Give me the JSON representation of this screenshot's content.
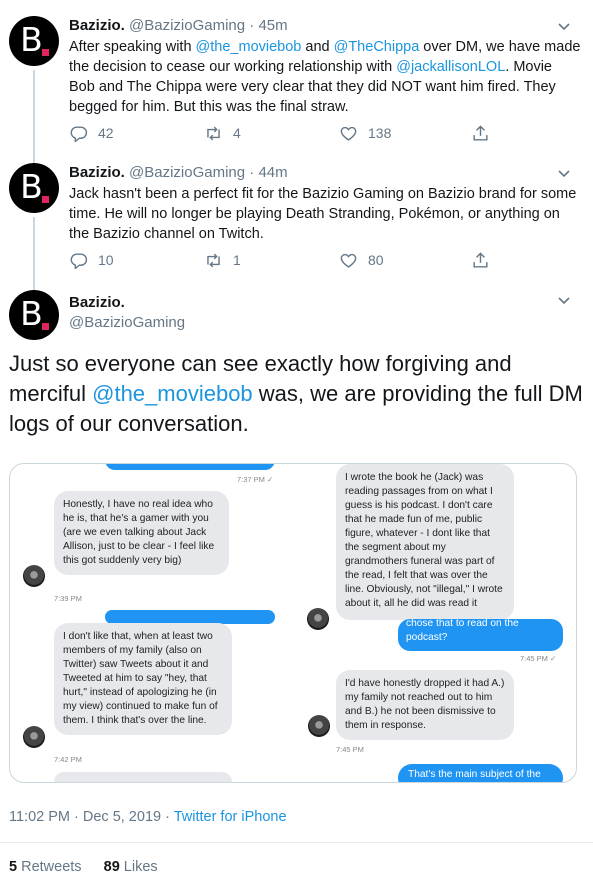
{
  "tweets": [
    {
      "name": "Bazizio.",
      "handle": "@BazizioGaming",
      "sep": " · ",
      "time": "45m",
      "segments": [
        {
          "t": "After speaking with ",
          "link": false
        },
        {
          "t": "@the_moviebob",
          "link": true
        },
        {
          "t": " and ",
          "link": false
        },
        {
          "t": "@TheChippa",
          "link": true
        },
        {
          "t": " over DM, we have made the decision to cease our working relationship with ",
          "link": false
        },
        {
          "t": "@jackallisonLOL",
          "link": true
        },
        {
          "t": ". Movie Bob and The Chippa were very clear that they did NOT want him fired. They begged for him. But this was the final straw.",
          "link": false
        }
      ],
      "replies": "42",
      "retweets": "4",
      "likes": "138"
    },
    {
      "name": "Bazizio.",
      "handle": "@BazizioGaming",
      "sep": " · ",
      "time": "44m",
      "segments": [
        {
          "t": "Jack hasn't been a perfect fit for the Bazizio Gaming on Bazizio brand for some time. He will no longer be playing Death Stranding, Pokémon, or anything on the Bazizio channel on Twitch.",
          "link": false
        }
      ],
      "replies": "10",
      "retweets": "1",
      "likes": "80"
    }
  ],
  "main": {
    "name": "Bazizio.",
    "handle": "@BazizioGaming",
    "text_before": "Just so everyone can see exactly how forgiving and merciful ",
    "text_link": "@the_moviebob",
    "text_after": " was, we are providing the full DM logs of our conversation.",
    "dm": {
      "left": {
        "time1": "7:37 PM ✓",
        "msg1": "Honestly, I have no real idea who he is, that he's a gamer with you (are we even talking about Jack Allison, just to be clear - I feel like this got suddenly very big)",
        "time2": "7:39 PM",
        "msg2": "I don't like that, when at least two members of my family (also on Twitter) saw Tweets about it and Tweeted at him to say \"hey, that hurt,\" instead of apologizing he (in my view) continued to make fun of them. I think that's over the line.",
        "time3": "7:42 PM"
      },
      "right": {
        "msg1": "I wrote the book he (Jack) was reading passages from on what I guess is his podcast. I don't care that he made fun of me, public figure, whatever - I dont like that the segment about my grandmothers funeral was part of the read, I felt that was over the line. Obviously, not \"illegal,\" I wrote about it, all he did was read it",
        "sent1": "chose that to read on the podcast?",
        "time1": "7:45 PM ✓",
        "msg2": "I'd have honestly dropped it had A.) my family not reached out to him and B.) he not been dismissive to them in response.",
        "time2": "7:45 PM",
        "sent2": "That's the main subject of the"
      }
    },
    "timestamp": "11:02 PM · Dec 5, 2019 · ",
    "source": "Twitter for iPhone",
    "retweets_count": "5",
    "retweets_label": " Retweets",
    "likes_count": "89",
    "likes_label": " Likes"
  }
}
